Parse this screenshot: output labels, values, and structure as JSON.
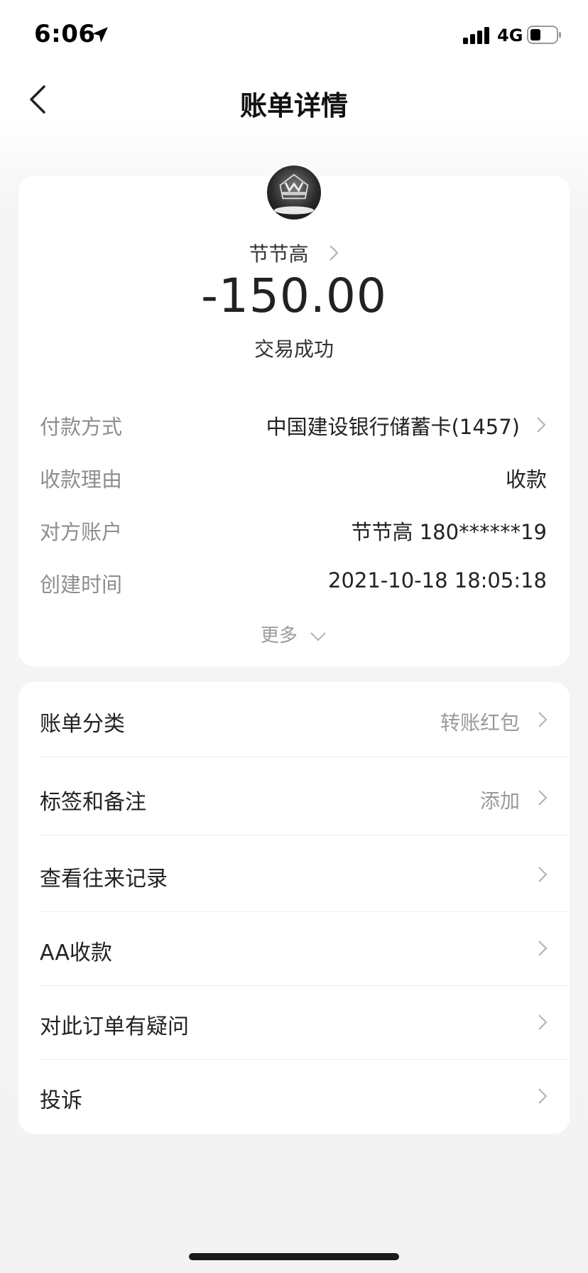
{
  "status_bar": {
    "time": "6:06",
    "network": "4G"
  },
  "nav": {
    "title": "账单详情"
  },
  "transaction": {
    "payee": "节节高",
    "amount": "-150.00",
    "status": "交易成功"
  },
  "details": [
    {
      "label": "付款方式",
      "value": "中国建设银行储蓄卡(1457)"
    },
    {
      "label": "收款理由",
      "value": "收款"
    },
    {
      "label": "对方账户",
      "value": "节节高 180******19"
    },
    {
      "label": "创建时间",
      "value": "2021-10-18 18:05:18"
    }
  ],
  "more_label": "更多",
  "menu": [
    {
      "label": "账单分类",
      "value": "转账红包"
    },
    {
      "label": "标签和备注",
      "value": "添加"
    },
    {
      "label": "查看往来记录",
      "value": ""
    },
    {
      "label": "AA收款",
      "value": ""
    },
    {
      "label": "对此订单有疑问",
      "value": ""
    },
    {
      "label": "投诉",
      "value": ""
    }
  ]
}
